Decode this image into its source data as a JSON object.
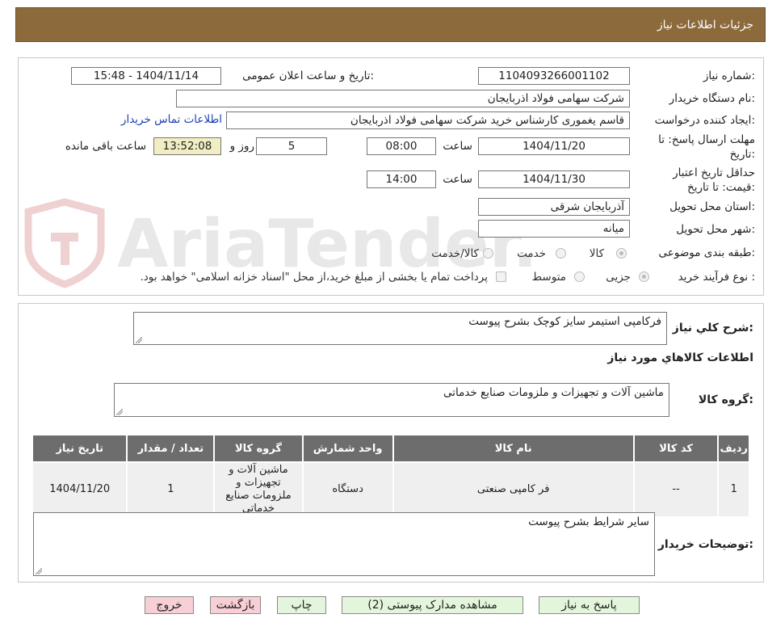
{
  "header": {
    "title": "جزئیات اطلاعات نیاز"
  },
  "details": {
    "need_number": {
      "label": "شماره نیاز:",
      "value": "1104093266001102"
    },
    "announce": {
      "label": "تاریخ و ساعت اعلان عمومی:",
      "value": "1404/11/14 - 15:48"
    },
    "buyer": {
      "label": "نام دستگاه خریدار:",
      "value": "شرکت سهامی فولاد اذربایجان"
    },
    "creator": {
      "label": "ایجاد کننده درخواست:",
      "value": "قاسم یغموری کارشناس خرید شرکت سهامی فولاد اذربایجان",
      "contact_link": "اطلاعات تماس خریدار"
    },
    "deadline": {
      "label": "مهلت ارسال پاسخ: تا تاریخ:",
      "date": "1404/11/20",
      "time_label": "ساعت",
      "time": "08:00",
      "days": "5",
      "days_label": "روز و",
      "remaining": "13:52:08",
      "remaining_label": "ساعت باقی مانده"
    },
    "validity": {
      "label": "حداقل تاریخ اعتبار قیمت: تا تاریخ:",
      "date": "1404/11/30",
      "time_label": "ساعت",
      "time": "14:00"
    },
    "province": {
      "label": "استان محل تحویل:",
      "value": "آذربایجان شرقی"
    },
    "city": {
      "label": "شهر محل تحویل:",
      "value": "میانه"
    },
    "category": {
      "label": "طبقه بندی موضوعی:",
      "options": [
        "کالا",
        "خدمت",
        "کالا/خدمت"
      ],
      "selected": "کالا"
    },
    "process": {
      "label": "نوع فرآیند خرید :",
      "options": [
        "جزیی",
        "متوسط"
      ],
      "selected": "جزیی",
      "payment_note": "پرداخت تمام یا بخشی از مبلغ خرید،از محل \"اسناد خزانه اسلامی\" خواهد بود."
    }
  },
  "summary": {
    "label": "شرح کلي نياز:",
    "value": "فرکامپی استیمر سایز کوچک بشرح پیوست",
    "items_title": "اطلاعات کالاهاي مورد نياز",
    "group_label": "گروه کالا:",
    "group_value": "ماشین آلات و تجهیزات و ملزومات صنایع خدماتی"
  },
  "table": {
    "headers": [
      "ردیف",
      "کد کالا",
      "نام کالا",
      "واحد شمارش",
      "گروه کالا",
      "تعداد / مقدار",
      "تاریخ نیاز"
    ],
    "rows": [
      [
        "1",
        "--",
        "فر کامپی صنعتی",
        "دستگاه",
        "ماشین آلات و تجهیزات و ملزومات صنایع خدماتی",
        "1",
        "1404/11/20"
      ]
    ]
  },
  "notes": {
    "label": "توضیحات خریدار:",
    "value": "سایر شرایط بشرح پیوست"
  },
  "buttons": {
    "reply": "پاسخ به نیاز",
    "attachments": "مشاهده مدارک پیوستی (2)",
    "print": "چاپ",
    "back": "بازگشت",
    "exit": "خروج"
  },
  "watermark": {
    "text": "AriaTender.neT"
  },
  "colors": {
    "header_bg": "#8c6a3c",
    "table_header_bg": "#6d6d6d",
    "green_button": "#e3f6dc",
    "pink_button": "#f7cfd4",
    "remaining_bg": "#f1eec4",
    "link": "#1a3fb5"
  }
}
